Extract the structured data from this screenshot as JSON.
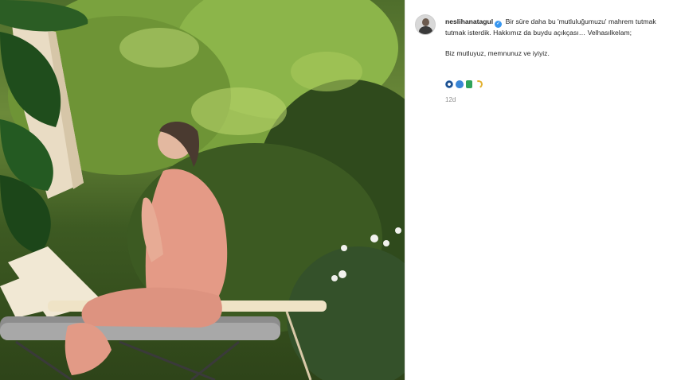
{
  "post": {
    "username": "neslihanatagul",
    "caption_line1": "Bir süre daha bu 'mutluluğumuzu' mahrem tutmak tutmak isterdik. Hakkımız da buydu açıkçası… Velhasılkelam;",
    "caption_line2": "Biz mutluyuz, memnunuz ve iyiyiz.",
    "time_ago": "12d"
  },
  "icons": {
    "verified": "verified-badge-icon",
    "emojis": [
      "nazar-amulet-icon",
      "blue-drop-icon",
      "green-charm-icon",
      "golden-ring-icon"
    ]
  },
  "colors": {
    "verified_blue": "#3897f0",
    "text": "#262626",
    "muted": "#8e8e8e"
  }
}
